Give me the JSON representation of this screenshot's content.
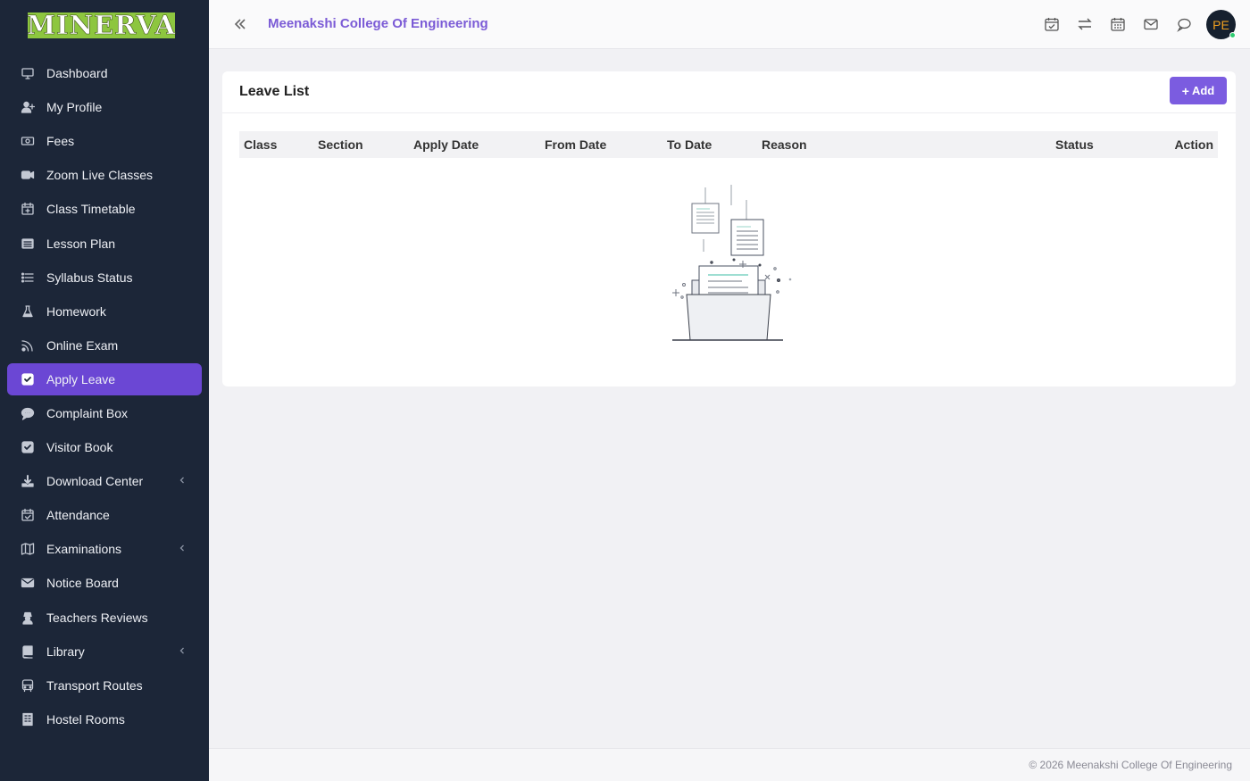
{
  "brand": {
    "logo_text": "MINERVA"
  },
  "sidebar": {
    "items": [
      {
        "label": "Dashboard",
        "icon": "monitor-icon",
        "has_submenu": false,
        "active": false
      },
      {
        "label": "My Profile",
        "icon": "user-plus-icon",
        "has_submenu": false,
        "active": false
      },
      {
        "label": "Fees",
        "icon": "money-icon",
        "has_submenu": false,
        "active": false
      },
      {
        "label": "Zoom Live Classes",
        "icon": "video-icon",
        "has_submenu": false,
        "active": false
      },
      {
        "label": "Class Timetable",
        "icon": "calendar-plus-icon",
        "has_submenu": false,
        "active": false
      },
      {
        "label": "Lesson Plan",
        "icon": "list-alt-icon",
        "has_submenu": false,
        "active": false
      },
      {
        "label": "Syllabus Status",
        "icon": "list-icon",
        "has_submenu": false,
        "active": false
      },
      {
        "label": "Homework",
        "icon": "flask-icon",
        "has_submenu": false,
        "active": false
      },
      {
        "label": "Online Exam",
        "icon": "rss-icon",
        "has_submenu": false,
        "active": false
      },
      {
        "label": "Apply Leave",
        "icon": "check-square-icon",
        "has_submenu": false,
        "active": true
      },
      {
        "label": "Complaint Box",
        "icon": "comment-icon",
        "has_submenu": false,
        "active": false
      },
      {
        "label": "Visitor Book",
        "icon": "check-square-icon",
        "has_submenu": false,
        "active": false
      },
      {
        "label": "Download Center",
        "icon": "download-icon",
        "has_submenu": true,
        "active": false
      },
      {
        "label": "Attendance",
        "icon": "calendar-check-icon",
        "has_submenu": false,
        "active": false
      },
      {
        "label": "Examinations",
        "icon": "map-icon",
        "has_submenu": true,
        "active": false
      },
      {
        "label": "Notice Board",
        "icon": "envelope-icon",
        "has_submenu": false,
        "active": false
      },
      {
        "label": "Teachers Reviews",
        "icon": "user-secret-icon",
        "has_submenu": false,
        "active": false
      },
      {
        "label": "Library",
        "icon": "book-icon",
        "has_submenu": true,
        "active": false
      },
      {
        "label": "Transport Routes",
        "icon": "bus-icon",
        "has_submenu": false,
        "active": false
      },
      {
        "label": "Hostel Rooms",
        "icon": "building-icon",
        "has_submenu": false,
        "active": false
      }
    ]
  },
  "header": {
    "title": "Meenakshi College Of Engineering",
    "icons": [
      "calendar-check-icon",
      "exchange-icon",
      "calendar-icon",
      "envelope-icon",
      "chat-icon"
    ],
    "avatar_initials": "PE",
    "status_color": "#2ecc71"
  },
  "main": {
    "card_title": "Leave List",
    "add_button_label": "Add",
    "table": {
      "columns": [
        "Class",
        "Section",
        "Apply Date",
        "From Date",
        "To Date",
        "Reason",
        "Status",
        "Action"
      ],
      "rows": []
    }
  },
  "footer": {
    "text": "© 2026 Meenakshi College Of Engineering"
  },
  "colors": {
    "sidebar_bg": "#1c2638",
    "accent": "#6b47d4",
    "button": "#7b5ce0",
    "title": "#7b5bd6",
    "logo_bg": "#8dc63f"
  }
}
